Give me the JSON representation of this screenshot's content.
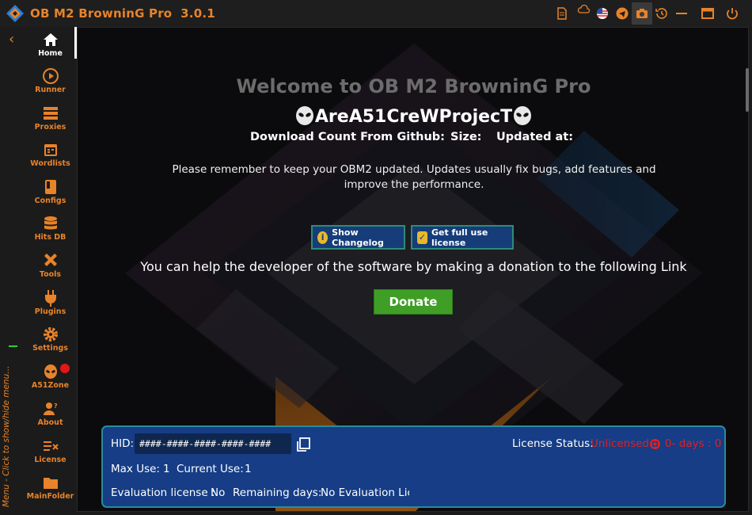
{
  "app": {
    "title": "OB M2 BrowninG Pro  3.0.1",
    "accent": "#e8832a"
  },
  "titlebar_icons": [
    "document-icon",
    "cloud-icon",
    "us-flag-icon",
    "telegram-icon",
    "camera-icon",
    "history-icon",
    "minimize-icon",
    "maximize-icon",
    "power-icon"
  ],
  "sidebar": {
    "collapse_glyph": "‹",
    "menu_hint": "Menu - Click to show/hide menu...",
    "items": [
      {
        "label": "Home",
        "icon": "home-icon"
      },
      {
        "label": "Runner",
        "icon": "play-icon"
      },
      {
        "label": "Proxies",
        "icon": "server-icon"
      },
      {
        "label": "Wordlists",
        "icon": "calendar-icon"
      },
      {
        "label": "Configs",
        "icon": "config-icon"
      },
      {
        "label": "Hits DB",
        "icon": "database-icon"
      },
      {
        "label": "Tools",
        "icon": "tools-icon"
      },
      {
        "label": "Plugins",
        "icon": "plug-icon"
      },
      {
        "label": "Settings",
        "icon": "gear-icon"
      },
      {
        "label": "A51Zone",
        "icon": "alien-icon"
      },
      {
        "label": "About",
        "icon": "user-question-icon"
      },
      {
        "label": "License",
        "icon": "license-icon"
      },
      {
        "label": "MainFolder",
        "icon": "folder-icon"
      }
    ]
  },
  "main": {
    "welcome": "Welcome to OB M2 BrowninG Pro",
    "crew": "AreA51CreWProjecT",
    "download_count_label": "Download Count From Github:",
    "size_label": "Size:",
    "updated_label": "Updated at:",
    "reminder": "Please remember to keep your OBM2 updated. Updates usually fix bugs, add features and improve the performance.",
    "changelog_button": "Show Changelog",
    "license_button": "Get full use license",
    "help_text": "You can help the developer of the software by making a donation to the following Link",
    "donate_button": "Donate"
  },
  "license": {
    "hid_label": "HID:",
    "hid_value": "####-####-####-####-####",
    "status_label": "License Status:",
    "status_value": "Unlicensed",
    "days_value": "0- days : 0",
    "max_use_label": "Max Use:",
    "max_use_value": "1",
    "current_use_label": "Current Use:",
    "current_use_value": "1",
    "evaluation_label": "Evaluation license :",
    "evaluation_value": "No",
    "remaining_label": "Remaining days:",
    "remaining_value": "No Evaluation Lice"
  }
}
